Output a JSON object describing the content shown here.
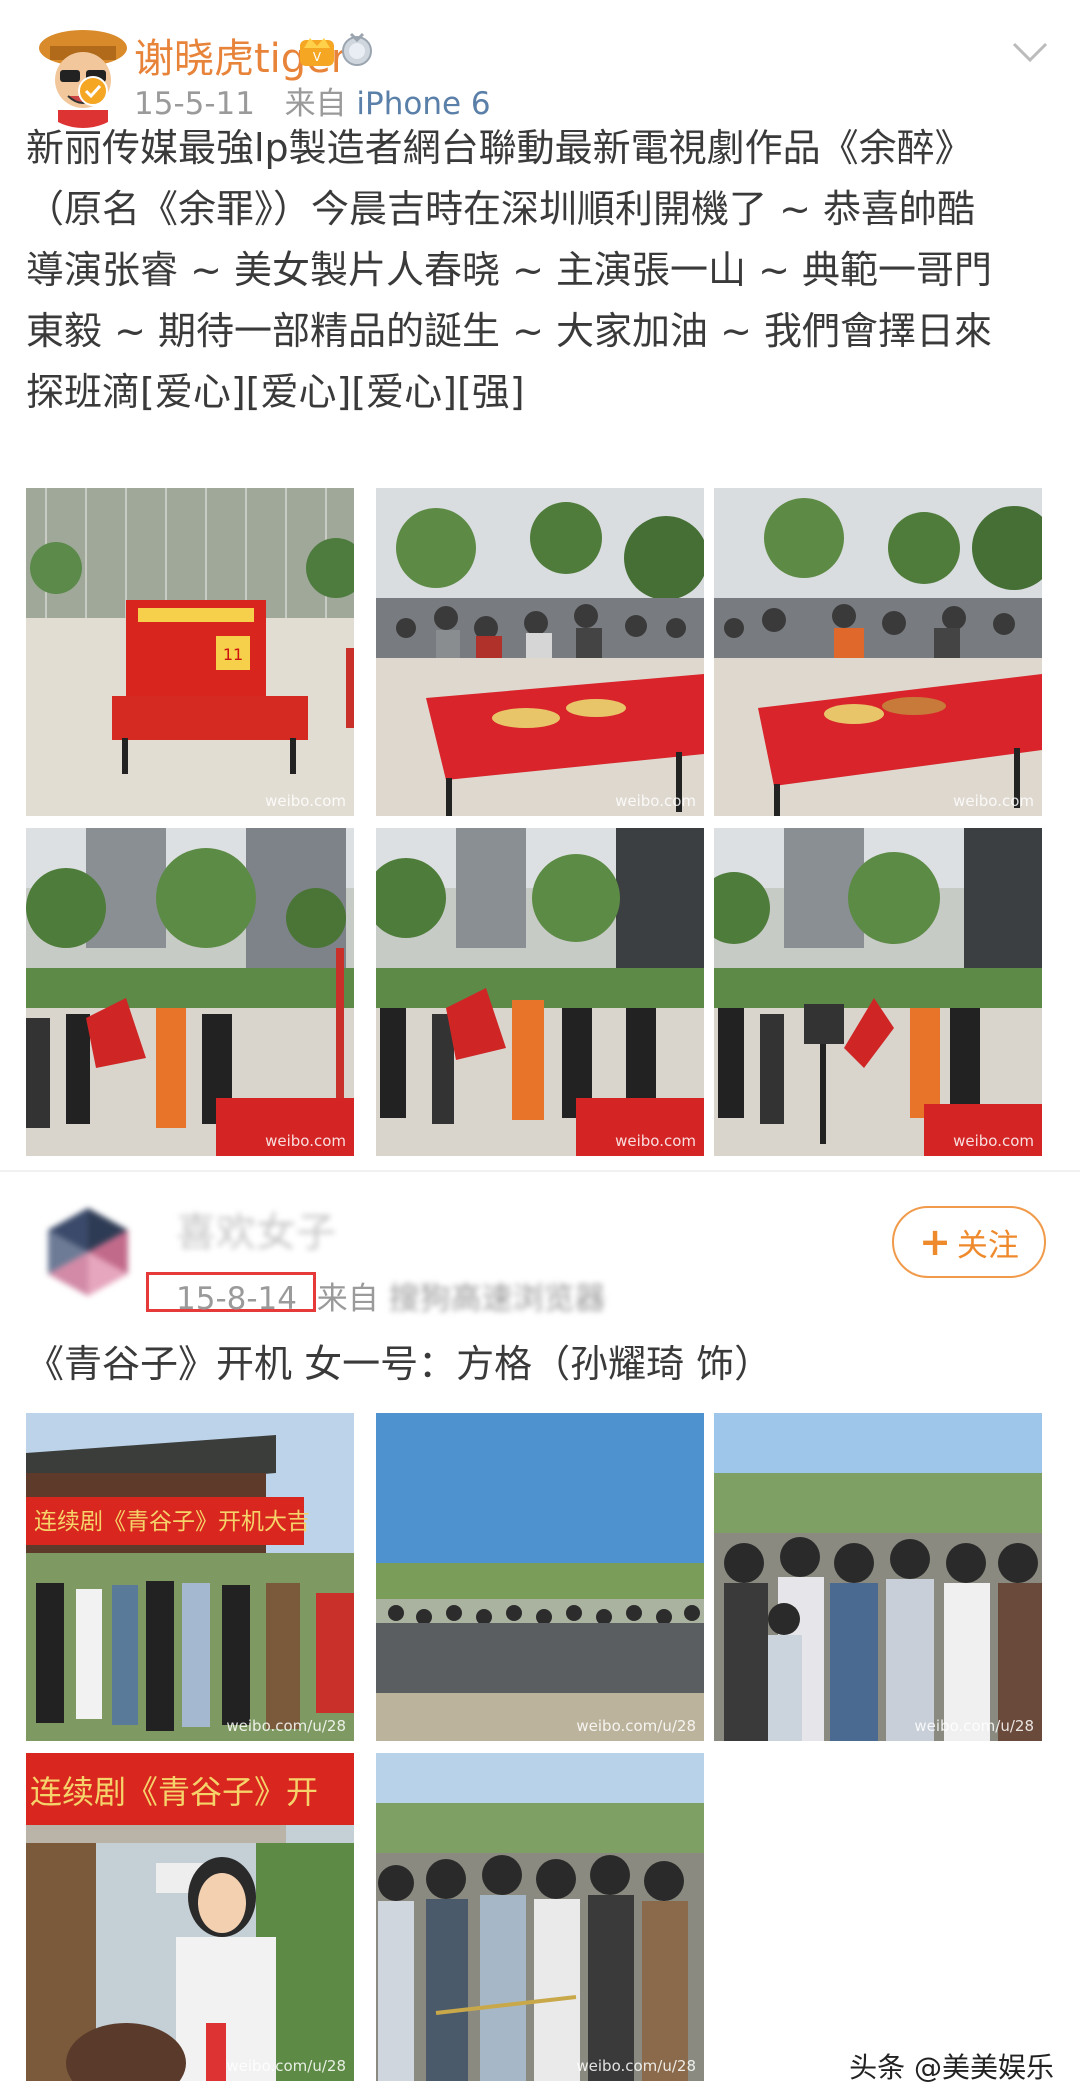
{
  "post1": {
    "username": "谢晓虎tiger",
    "date": "15-5-11",
    "source_prefix": "来自",
    "source": "iPhone 6",
    "text_lines": [
      "新丽传媒最強lp製造者網台聯動最新電視劇作品《余醉》",
      "（原名《余罪》）今晨吉時在深圳順利開機了 ~ 恭喜帥酷",
      "導演张睿 ~ 美女製片人春晓 ~ 主演張一山 ~ 典範一哥門",
      "東毅 ~ 期待一部精品的誕生 ~ 大家加油 ~ 我們會擇日來",
      "探班滴[爱心][爱心][爱心][强]"
    ],
    "photo_watermark": "weibo.com",
    "banner_text": "11"
  },
  "post2": {
    "username": "喜欢女子",
    "date": "15-8-14",
    "source_prefix": "来自",
    "source": "搜狗高速浏览器",
    "follow_label": "关注",
    "text": "《青谷子》开机 女一号：方格（孙耀琦 饰）",
    "photo_watermark": "weibo.com/u/28",
    "banner_text_1": "连续剧《青谷子》开机大吉",
    "banner_text_2": "连续剧《青谷子》开"
  },
  "footer": {
    "brand": "头条 @美美娱乐"
  },
  "colors": {
    "accent_orange": "#ee8a2c",
    "link_blue": "#5a7fa8",
    "highlight_red": "#e63a3a"
  }
}
